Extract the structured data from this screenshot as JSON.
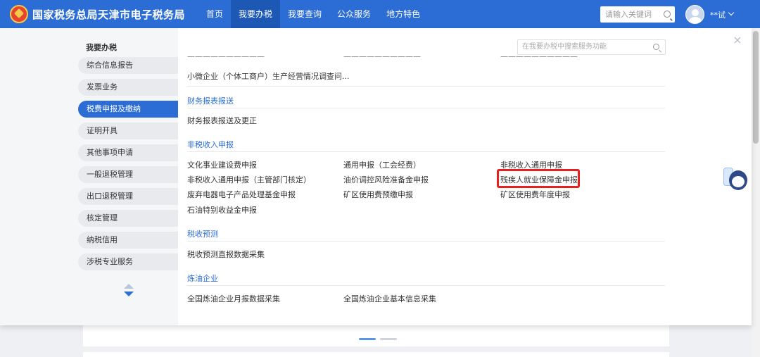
{
  "header": {
    "title": "国家税务总局天津市电子税务局",
    "nav": [
      "首页",
      "我要办税",
      "我要查询",
      "公众服务",
      "地方特色"
    ],
    "active_nav": 1,
    "search_placeholder": "请输入关键词",
    "user": "**试"
  },
  "sidebar": {
    "title": "我要办税",
    "items": [
      "综合信息报告",
      "发票业务",
      "税费申报及缴纳",
      "证明开具",
      "其他事项申请",
      "一般退税管理",
      "出口退税管理",
      "核定管理",
      "纳税信用",
      "涉税专业服务"
    ],
    "active_index": 2
  },
  "content": {
    "search_placeholder": "在我要办税中搜索服务功能",
    "close": "×",
    "partial_row": [
      "——————————",
      "——————————",
      "——————————"
    ],
    "top_item": "小微企业（个体工商户）生产经营情况调查问...",
    "sections": [
      {
        "title": "财务报表报送",
        "items": [
          "财务报表报送及更正"
        ]
      },
      {
        "title": "非税收入申报",
        "items": [
          "文化事业建设费申报",
          "通用申报（工会经费）",
          "非税收入通用申报",
          "非税收入通用申报（主管部门核定）",
          "油价调控风险准备金申报",
          "残疾人就业保障金申报",
          "废弃电器电子产品处理基金申报",
          "矿区使用费预缴申报",
          "矿区使用费年度申报",
          "石油特别收益金申报"
        ]
      },
      {
        "title": "税收预测",
        "items": [
          "税收预测直报数据采集"
        ]
      },
      {
        "title": "炼油企业",
        "items": [
          "全国炼油企业月报数据采集",
          "全国炼油企业基本信息采集"
        ]
      }
    ],
    "highlighted_item": "残疾人就业保障金申报"
  },
  "colors": {
    "brand": "#2b6dd4",
    "highlight": "#e8201f"
  }
}
